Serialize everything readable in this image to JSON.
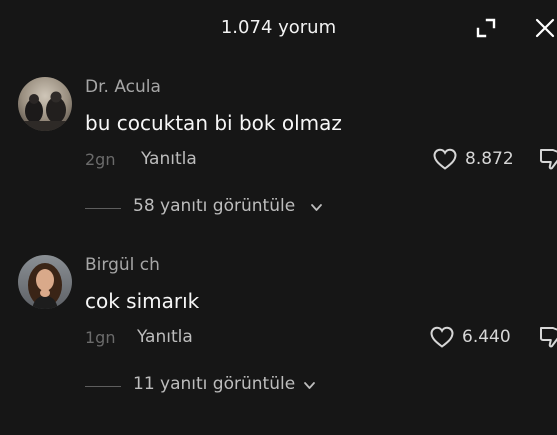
{
  "header": {
    "title": "1.074 yorum"
  },
  "comments": [
    {
      "username": "Dr. Acula",
      "text": "bu cocuktan bi bok olmaz",
      "time": "2gn",
      "reply_label": "Yanıtla",
      "likes": "8.872",
      "replies_label": "58 yanıtı görüntüle"
    },
    {
      "username": "Birgül ch",
      "text": "cok simarık",
      "time": "1gn",
      "reply_label": "Yanıtla",
      "likes": "6.440",
      "replies_label": "11 yanıtı görüntüle"
    }
  ],
  "icons": {
    "expand": "expand-icon",
    "close": "close-icon",
    "like": "heart-icon",
    "dislike": "thumbs-down-icon",
    "chevron": "chevron-down-icon"
  },
  "colors": {
    "background": "#161616",
    "username": "#a6a6a6",
    "text": "#f7f7f7",
    "secondary": "#6b6b6b"
  }
}
